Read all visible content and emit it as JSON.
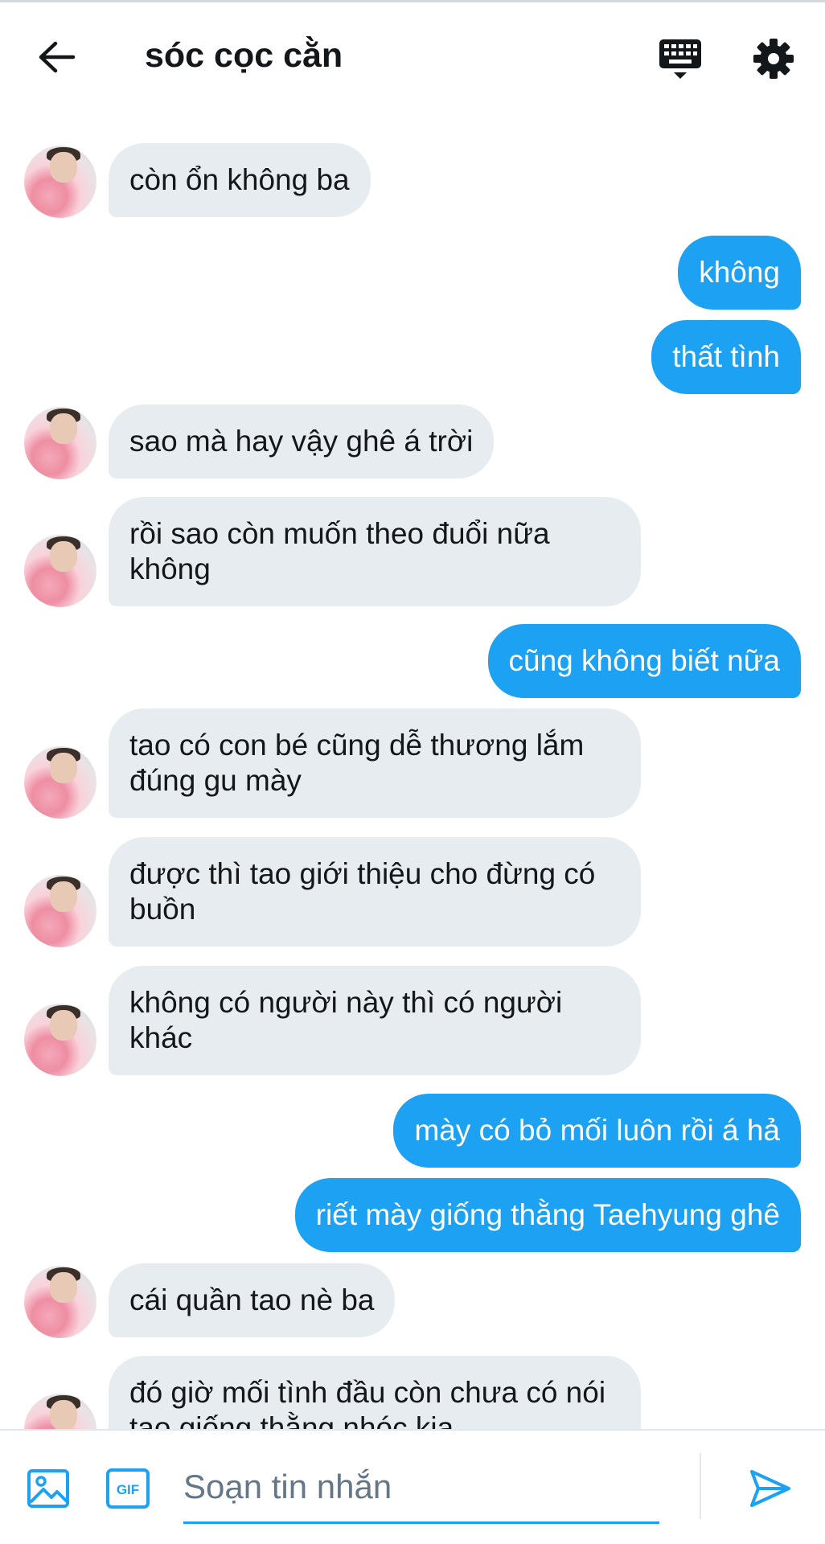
{
  "header": {
    "title": "sóc cọc cằn",
    "back_icon": "arrow-left-icon",
    "keyboard_icon": "keyboard-icon",
    "settings_icon": "gear-icon"
  },
  "colors": {
    "accent": "#1da1f2",
    "incoming_bubble": "#e6ecf0",
    "text": "#14171a",
    "muted": "#657786"
  },
  "messages": [
    {
      "side": "in",
      "text": "còn ổn không ba"
    },
    {
      "side": "out",
      "text": "không"
    },
    {
      "side": "out",
      "text": "thất tình"
    },
    {
      "side": "in",
      "text": "sao mà hay vậy ghê á trời"
    },
    {
      "side": "in",
      "text": "rồi sao còn muốn theo đuổi nữa\nkhông"
    },
    {
      "side": "out",
      "text": "cũng không biết nữa"
    },
    {
      "side": "in",
      "text": "tao có con bé cũng dễ thương lắm\nđúng gu mày"
    },
    {
      "side": "in",
      "text": "được thì tao giới thiệu cho đừng có\nbuồn"
    },
    {
      "side": "in",
      "text": "không có người này thì có người\nkhác"
    },
    {
      "side": "out",
      "text": "mày có bỏ mối luôn rồi á hả"
    },
    {
      "side": "out",
      "text": "riết mày giống thằng Taehyung ghê"
    },
    {
      "side": "in",
      "text": "cái quần tao nè ba"
    },
    {
      "side": "in",
      "text": "đó giờ mối tình đầu còn chưa có nói\ntao giống thằng nhóc kia"
    }
  ],
  "composer": {
    "placeholder": "Soạn tin nhắn",
    "value": "",
    "image_icon": "image-icon",
    "gif_icon": "gif-icon",
    "gif_label": "GIF",
    "send_icon": "send-icon"
  }
}
